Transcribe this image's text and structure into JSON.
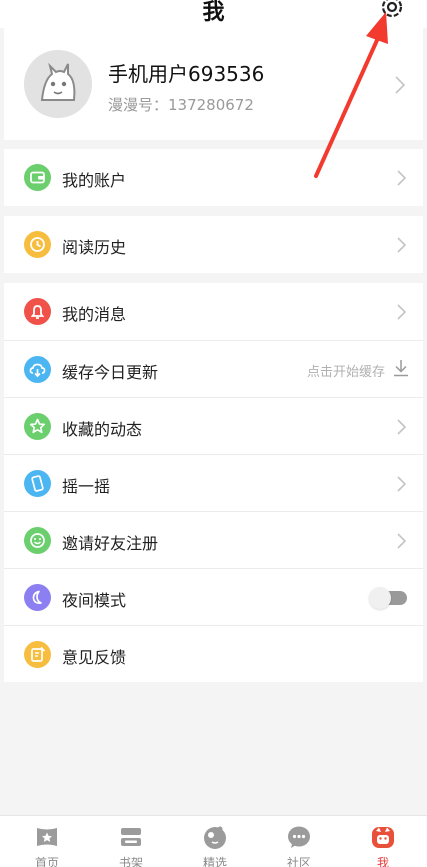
{
  "header": {
    "title": "我",
    "settings_icon": "gear-icon"
  },
  "profile": {
    "name": "手机用户693536",
    "id_text": "漫漫号：137280672"
  },
  "menu": {
    "account": {
      "label": "我的账户",
      "icon": "wallet-icon",
      "color": "#6ccf6e"
    },
    "history": {
      "label": "阅读历史",
      "icon": "clock-icon",
      "color": "#f7bd3f"
    },
    "messages": {
      "label": "我的消息",
      "icon": "bell-icon",
      "color": "#f05148"
    },
    "cache": {
      "label": "缓存今日更新",
      "icon": "cloud-download-icon",
      "color": "#4bb6f2",
      "hint": "点击开始缓存"
    },
    "favorites": {
      "label": "收藏的动态",
      "icon": "star-icon",
      "color": "#6ccf6e"
    },
    "shake": {
      "label": "摇一摇",
      "icon": "phone-shake-icon",
      "color": "#4bb6f2"
    },
    "invite": {
      "label": "邀请好友注册",
      "icon": "smile-icon",
      "color": "#6ccf6e"
    },
    "night": {
      "label": "夜间模式",
      "icon": "moon-icon",
      "color": "#8c7ff2",
      "enabled": false
    },
    "feedback": {
      "label": "意见反馈",
      "icon": "edit-icon",
      "color": "#f7bd3f"
    }
  },
  "tabs": [
    {
      "label": "首页",
      "icon": "home-star-icon"
    },
    {
      "label": "书架",
      "icon": "bookshelf-icon"
    },
    {
      "label": "精选",
      "icon": "featured-icon"
    },
    {
      "label": "社区",
      "icon": "chat-bubble-icon"
    },
    {
      "label": "我",
      "icon": "profile-cat-icon",
      "active": true
    }
  ],
  "colors": {
    "accent": "#e83c3c",
    "annotation_arrow": "#f23a2f"
  }
}
